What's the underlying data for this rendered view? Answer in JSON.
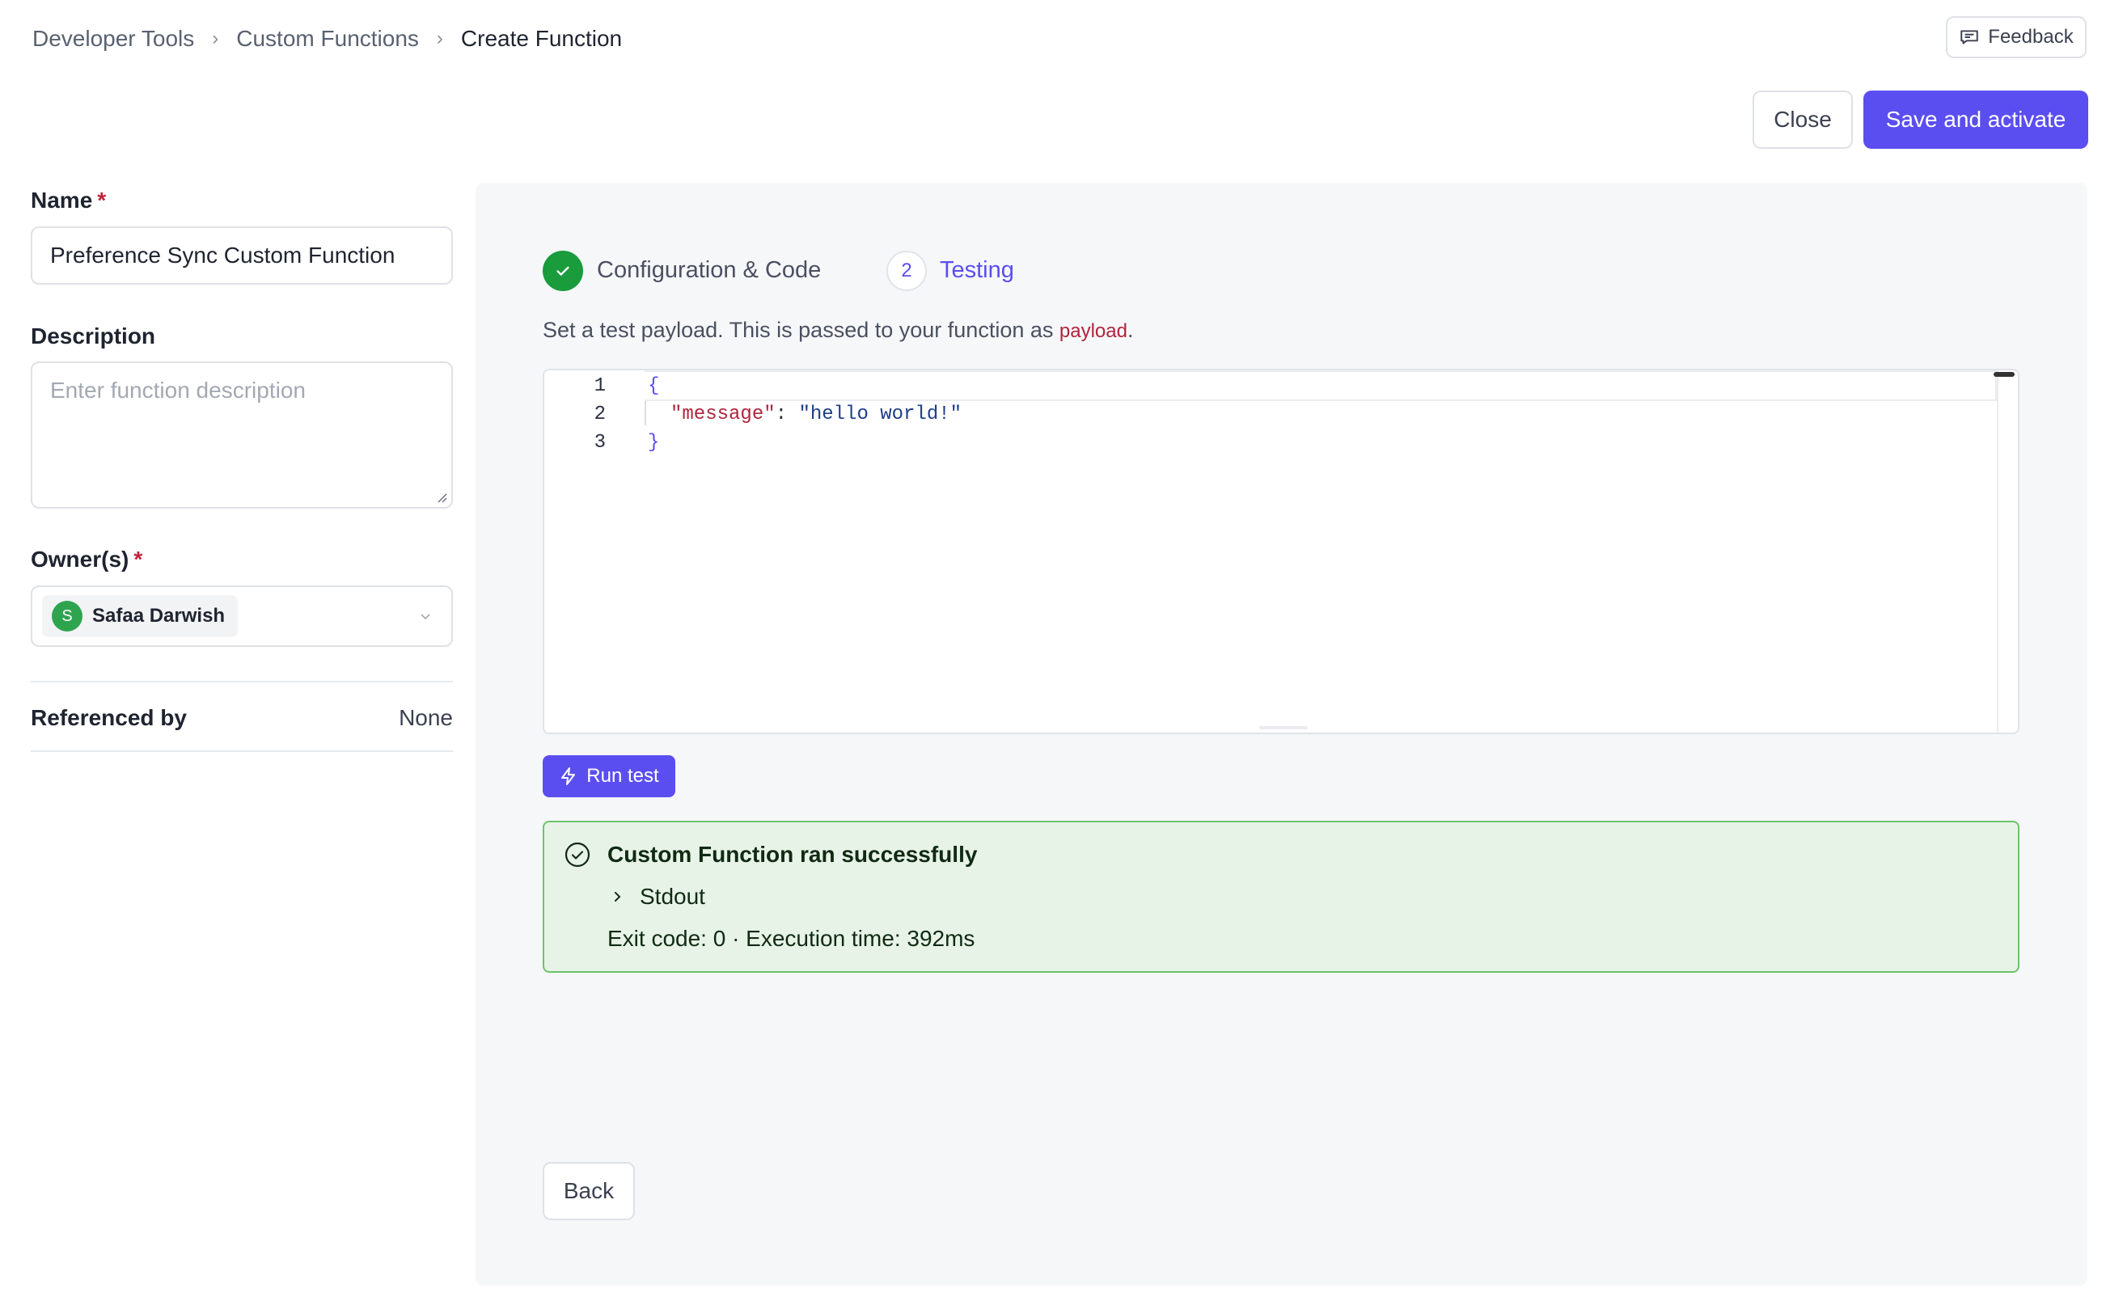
{
  "breadcrumb": {
    "items": [
      "Developer Tools",
      "Custom Functions",
      "Create Function"
    ]
  },
  "header": {
    "feedback_label": "Feedback",
    "close_label": "Close",
    "save_label": "Save and activate"
  },
  "form": {
    "name_label": "Name",
    "name_value": "Preference Sync Custom Function",
    "required_mark": "*",
    "description_label": "Description",
    "description_placeholder": "Enter function description",
    "owners_label": "Owner(s)",
    "owner": {
      "initial": "S",
      "name": "Safaa Darwish"
    },
    "referenced_by_label": "Referenced by",
    "referenced_by_value": "None"
  },
  "steps": [
    {
      "label": "Configuration & Code",
      "status": "complete",
      "icon": "check-icon"
    },
    {
      "number": "2",
      "label": "Testing",
      "status": "active"
    }
  ],
  "testing": {
    "hint_prefix": "Set a test payload. This is passed to your function as ",
    "hint_code": "payload",
    "hint_suffix": ".",
    "editor": {
      "line_numbers": [
        "1",
        "2",
        "3"
      ],
      "open_brace": "{",
      "key": "\"message\"",
      "colon": ": ",
      "value": "\"hello world!\"",
      "close_brace": "}"
    },
    "run_label": "Run test",
    "result": {
      "title": "Custom Function ran successfully",
      "stdout_label": "Stdout",
      "exit_info": "Exit code: 0 · Execution time: 392ms"
    },
    "back_label": "Back"
  },
  "colors": {
    "accent": "#5b4ef0",
    "success": "#1a9b3c",
    "success_bg": "#e8f3e7",
    "required": "#c0243c"
  }
}
